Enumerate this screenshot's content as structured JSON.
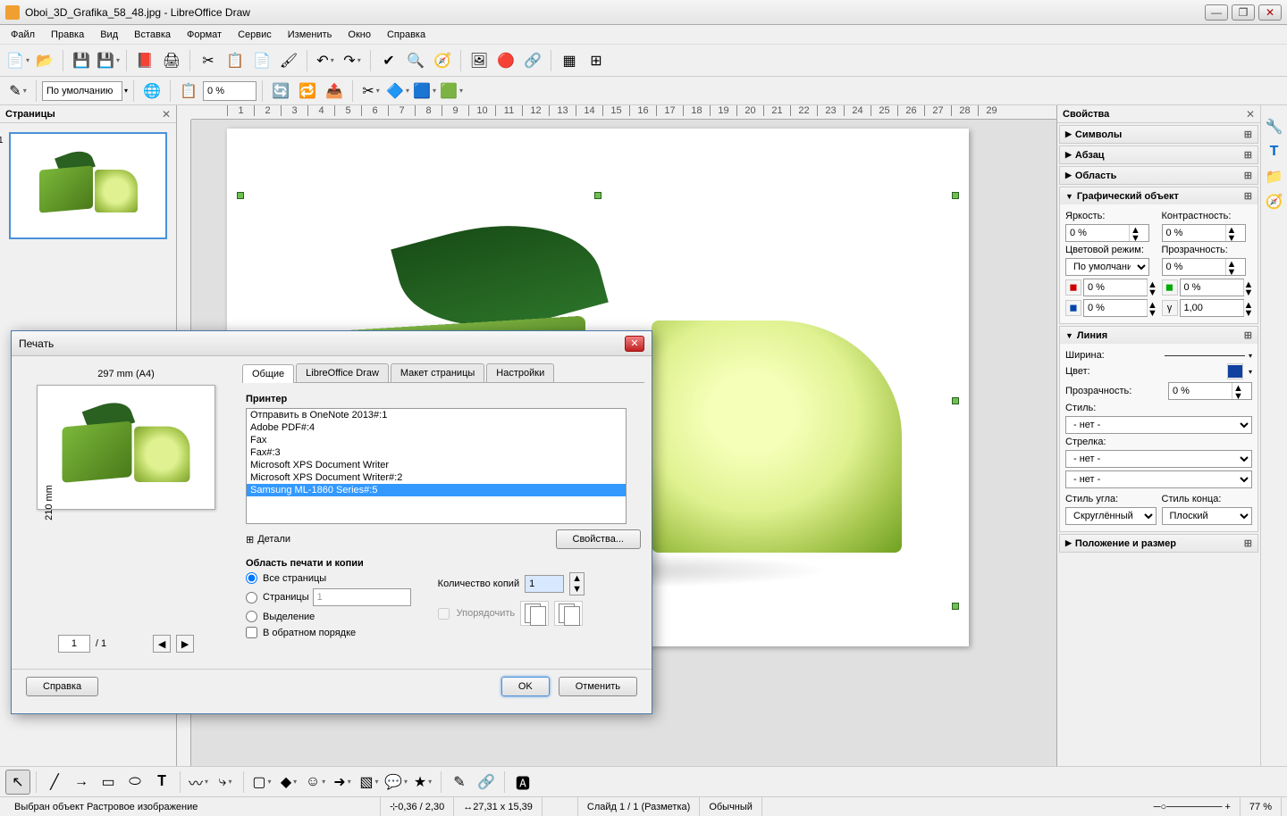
{
  "window": {
    "title": "Oboi_3D_Grafika_58_48.jpg - LibreOffice Draw"
  },
  "menu": {
    "file": "Файл",
    "edit": "Правка",
    "view": "Вид",
    "insert": "Вставка",
    "format": "Формат",
    "tools": "Сервис",
    "modify": "Изменить",
    "window": "Окно",
    "help": "Справка"
  },
  "toolbar2": {
    "style": "По умолчанию",
    "zoom": "0 %"
  },
  "pages_panel": {
    "title": "Страницы",
    "thumb_num": "1"
  },
  "ruler": {
    "marks": [
      "1",
      "2",
      "3",
      "4",
      "5",
      "6",
      "7",
      "8",
      "9",
      "10",
      "11",
      "12",
      "13",
      "14",
      "15",
      "16",
      "17",
      "18",
      "19",
      "20",
      "21",
      "22",
      "23",
      "24",
      "25",
      "26",
      "27",
      "28",
      "29"
    ]
  },
  "props": {
    "title": "Свойства",
    "symbols": "Символы",
    "paragraph": "Абзац",
    "area": "Область",
    "graphic": "Графический объект",
    "brightness": "Яркость:",
    "contrast": "Контрастность:",
    "bright_val": "0 %",
    "contrast_val": "0 %",
    "colormode": "Цветовой режим:",
    "transparency": "Прозрачность:",
    "colormode_val": "По умолчанию",
    "trans_val": "0 %",
    "r_val": "0 %",
    "g_val": "0 %",
    "b_val": "0 %",
    "gamma": "1,00",
    "line": "Линия",
    "width": "Ширина:",
    "color": "Цвет:",
    "line_trans": "Прозрачность:",
    "line_trans_val": "0 %",
    "style": "Стиль:",
    "style_val": "- нет -",
    "arrow": "Стрелка:",
    "arrow_val": "- нет -",
    "arrow_val2": "- нет -",
    "corner": "Стиль угла:",
    "corner_val": "Скруглённый",
    "cap": "Стиль конца:",
    "cap_val": "Плоский",
    "position": "Положение и размер"
  },
  "dialog": {
    "title": "Печать",
    "page_w": "297 mm (A4)",
    "page_h": "210 mm",
    "page_num": "1",
    "page_total": "/ 1",
    "tabs": {
      "general": "Общие",
      "draw": "LibreOffice Draw",
      "layout": "Макет страницы",
      "settings": "Настройки"
    },
    "printer": "Принтер",
    "printers": [
      "Отправить в OneNote 2013#:1",
      "Adobe PDF#:4",
      "Fax",
      "Fax#:3",
      "Microsoft XPS Document Writer",
      "Microsoft XPS Document Writer#:2",
      "Samsung ML-1860 Series#:5"
    ],
    "selected_printer": 6,
    "details": "Детали",
    "properties": "Свойства...",
    "range_title": "Область печати и копии",
    "all": "Все страницы",
    "pages": "Страницы",
    "pages_val": "1",
    "selection": "Выделение",
    "reverse": "В обратном порядке",
    "copies": "Количество копий",
    "copies_val": "1",
    "collate": "Упорядочить",
    "help": "Справка",
    "ok": "OK",
    "cancel": "Отменить"
  },
  "status": {
    "selected": "Выбран объект Растровое изображение",
    "pos": "0,36 / 2,30",
    "size": "27,31 x 15,39",
    "slide": "Слайд 1 / 1 (Разметка)",
    "layout": "Обычный",
    "zoom": "77 %"
  }
}
